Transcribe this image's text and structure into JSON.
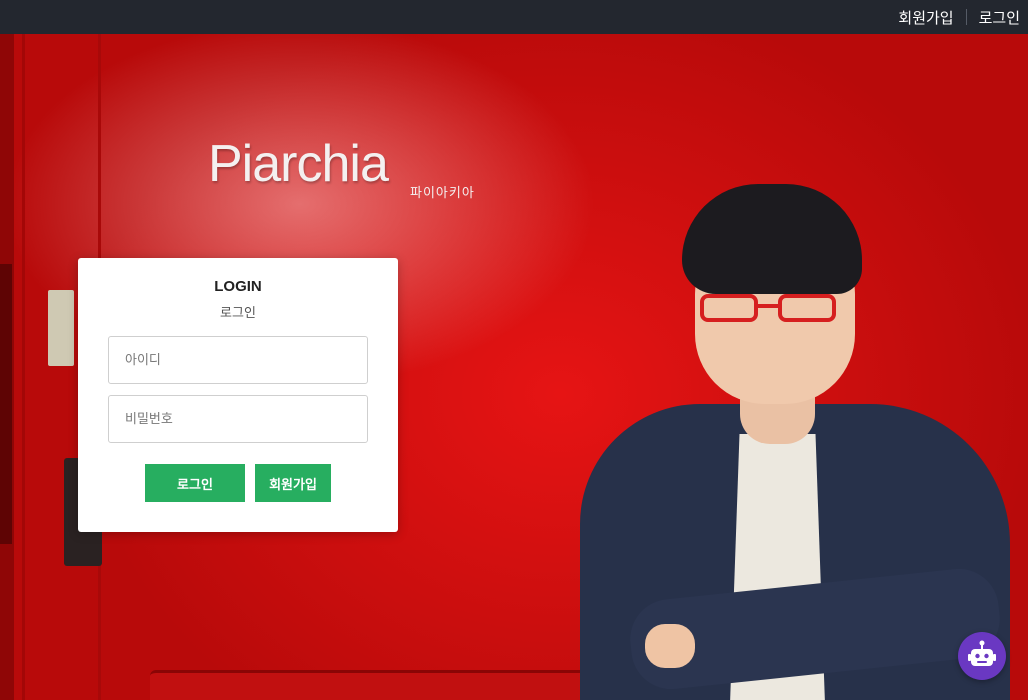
{
  "topbar": {
    "signup": "회원가입",
    "login": "로그인"
  },
  "hero": {
    "brand": "Piarchia",
    "brand_sub": "파이아키아"
  },
  "login_card": {
    "title": "LOGIN",
    "subtitle": "로그인",
    "id_placeholder": "아이디",
    "password_placeholder": "비밀번호",
    "login_button": "로그인",
    "signup_button": "회원가입"
  },
  "chatbot": {
    "icon": "robot-icon"
  },
  "colors": {
    "topbar": "#23272f",
    "accent_green": "#27ae60",
    "chatbot_purple": "#6a38c2",
    "background_red": "#d91010"
  }
}
